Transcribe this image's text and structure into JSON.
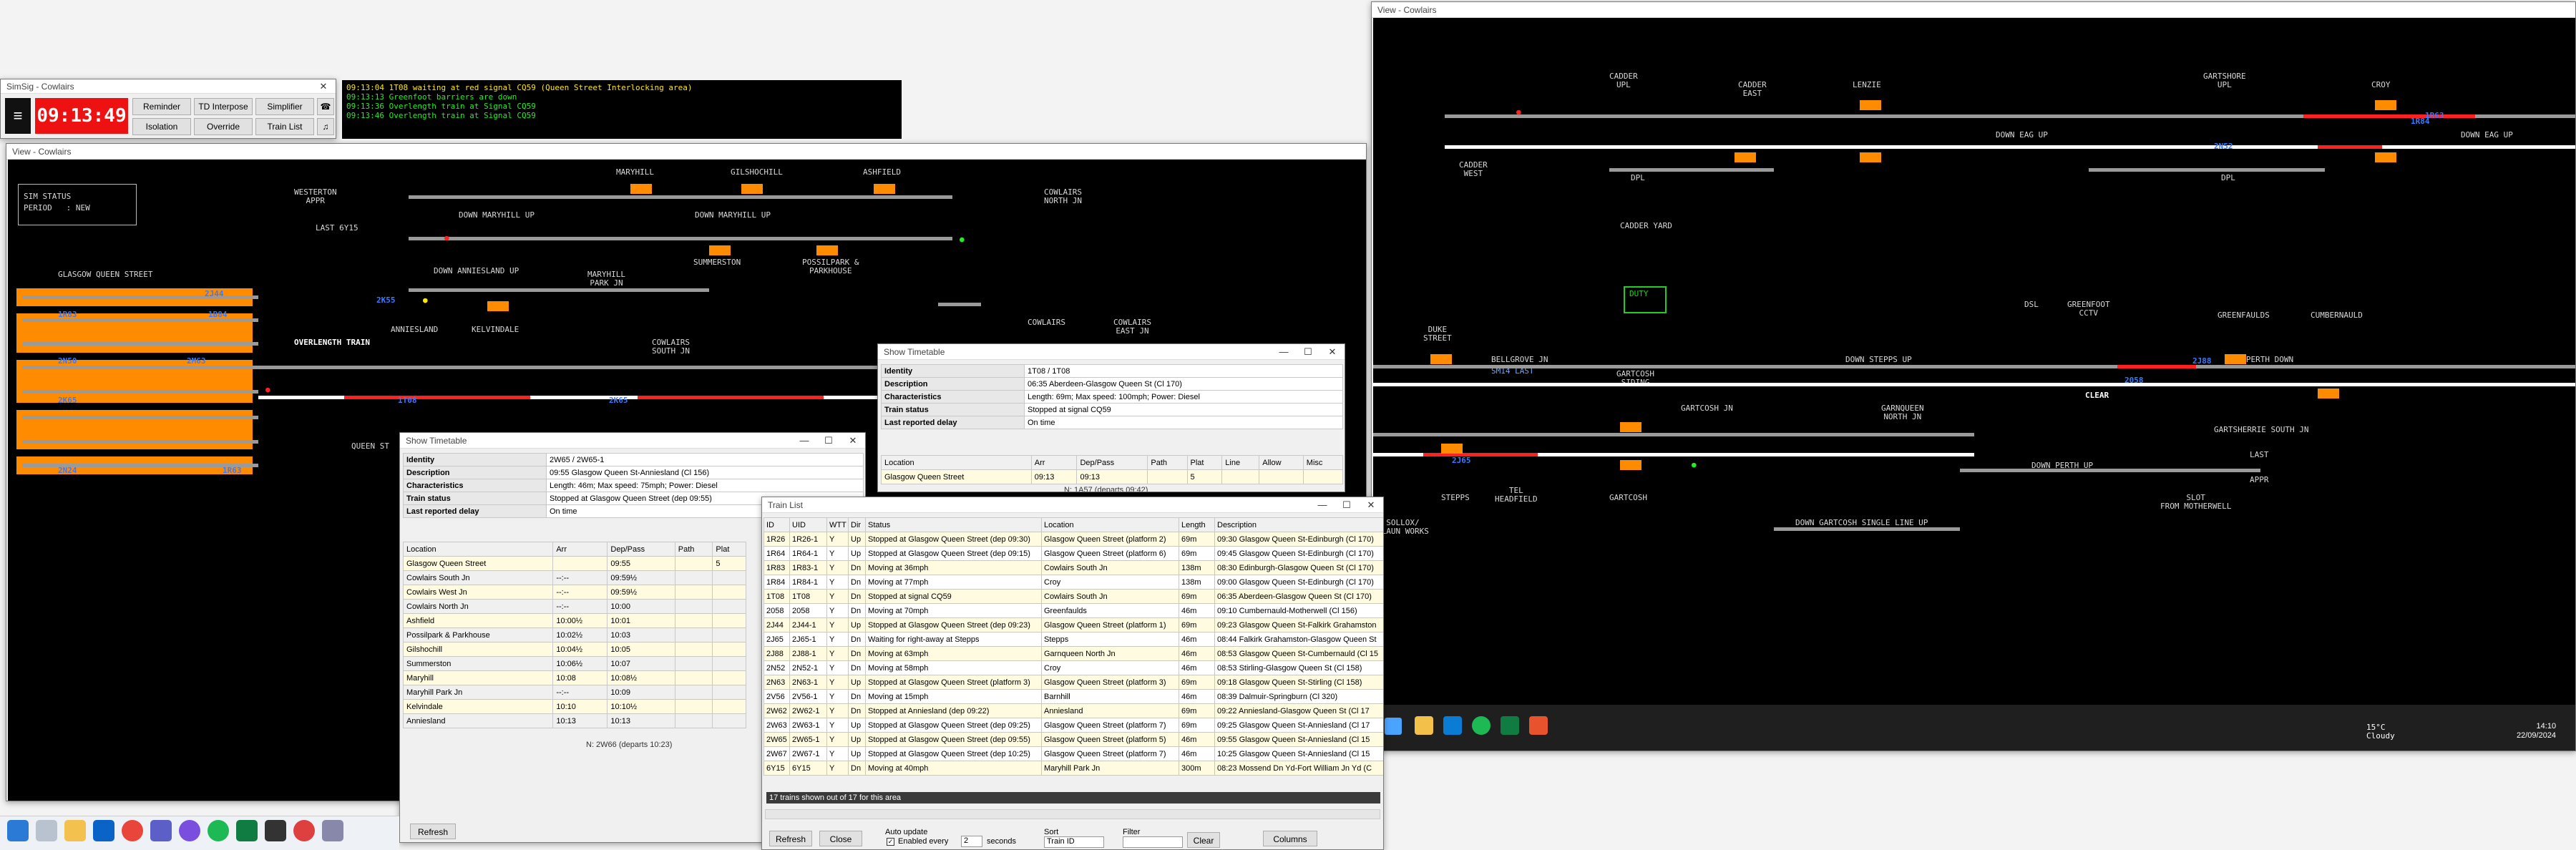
{
  "simsig": {
    "title": "SimSig - Cowlairs",
    "clock": "09:13:49",
    "buttons": {
      "reminder": "Reminder",
      "td_interpose": "TD Interpose",
      "simplifier": "Simplifier",
      "isolation": "Isolation",
      "override": "Override",
      "train_list": "Train List"
    },
    "messages": [
      "09:13:04 1T08 waiting at red signal CQ59 (Queen Street Interlocking area)",
      "09:13:13 Greenfoot barriers are down",
      "09:13:36 Overlength train at Signal CQ59",
      "09:13:46 Overlength train at Signal CQ59"
    ]
  },
  "left_view": {
    "title": "View - Cowlairs",
    "sim_status": "SIM STATUS",
    "period": "PERIOD   : NEW",
    "labels": {
      "westerton": "WESTERTON\nAPPR",
      "last_6y15": "LAST 6Y15",
      "glasgow_qs": "GLASGOW QUEEN STREET",
      "maryhill": "MARYHILL",
      "gilshochill": "GILSHOCHILL",
      "ashfield": "ASHFIELD",
      "cowlairs_north": "COWLAIRS\nNORTH JN",
      "down_maryhill_up": "DOWN MARYHILL UP",
      "down_anniesland_up": "DOWN ANNIESLAND UP",
      "maryhill_park": "MARYHILL\nPARK JN",
      "summerston": "SUMMERSTON",
      "possilpark": "POSSILPARK &\nPARKHOUSE",
      "anniesland": "ANNIESLAND",
      "kelvindale": "KELVINDALE",
      "overlength": "OVERLENGTH TRAIN",
      "cowlairs_south": "COWLAIRS\nSOUTH JN",
      "cowlairs": "COWLAIRS",
      "cowlairs_east": "COWLAIRS\nEAST JN",
      "queen_st": "QUEEN ST"
    },
    "headcodes": [
      "1R83",
      "1B84",
      "2N50",
      "2M63",
      "2K65",
      "1T08",
      "2N24",
      "2J44",
      "1R63",
      "2K65",
      "2K55"
    ]
  },
  "timetable_1": {
    "title": "Show Timetable",
    "fields": [
      {
        "k": "Identity",
        "v": "2W65 / 2W65-1"
      },
      {
        "k": "Description",
        "v": "09:55 Glasgow Queen St-Anniesland (Cl 156)"
      },
      {
        "k": "Characteristics",
        "v": "Length: 46m; Max speed: 75mph; Power: Diesel"
      },
      {
        "k": "Train status",
        "v": "Stopped at Glasgow Queen Street (dep 09:55)"
      },
      {
        "k": "Last reported delay",
        "v": "On time"
      }
    ],
    "columns": [
      "Location",
      "Arr",
      "Dep/Pass",
      "Path",
      "Plat"
    ],
    "rows": [
      [
        "Glasgow Queen Street",
        "",
        "09:55",
        "",
        "5"
      ],
      [
        "Cowlairs South Jn",
        "--:--",
        "09:59½",
        "",
        ""
      ],
      [
        "Cowlairs West Jn",
        "--:--",
        "09:59½",
        "",
        ""
      ],
      [
        "Cowlairs North Jn",
        "--:--",
        "10:00",
        "",
        ""
      ],
      [
        "Ashfield",
        "10:00½",
        "10:01",
        "",
        ""
      ],
      [
        "Possilpark & Parkhouse",
        "10:02½",
        "10:03",
        "",
        ""
      ],
      [
        "Gilshochill",
        "10:04½",
        "10:05",
        "",
        ""
      ],
      [
        "Summerston",
        "10:06½",
        "10:07",
        "",
        ""
      ],
      [
        "Maryhill",
        "10:08",
        "10:08½",
        "",
        ""
      ],
      [
        "Maryhill Park Jn",
        "--:--",
        "10:09",
        "",
        ""
      ],
      [
        "Kelvindale",
        "10:10",
        "10:10½",
        "",
        ""
      ],
      [
        "Anniesland",
        "10:13",
        "10:13",
        "",
        ""
      ]
    ],
    "footer": "N: 2W66 (departs 10:23)",
    "refresh": "Refresh"
  },
  "timetable_2": {
    "title": "Show Timetable",
    "fields": [
      {
        "k": "Identity",
        "v": "1T08 / 1T08"
      },
      {
        "k": "Description",
        "v": "06:35 Aberdeen-Glasgow Queen St (Cl 170)"
      },
      {
        "k": "Characteristics",
        "v": "Length: 69m; Max speed: 100mph; Power: Diesel"
      },
      {
        "k": "Train status",
        "v": "Stopped at signal CQ59"
      },
      {
        "k": "Last reported delay",
        "v": "On time"
      }
    ],
    "columns": [
      "Location",
      "Arr",
      "Dep/Pass",
      "Path",
      "Plat",
      "Line",
      "Allow",
      "Misc"
    ],
    "rows": [
      [
        "Glasgow Queen Street",
        "09:13",
        "09:13",
        "",
        "5",
        "",
        "",
        ""
      ]
    ],
    "footer": "N: 1A57 (departs 09:42)"
  },
  "train_list": {
    "title": "Train List",
    "columns": [
      "ID",
      "UID",
      "WTT",
      "Dir",
      "Status",
      "Location",
      "Length",
      "Description"
    ],
    "rows": [
      [
        "1R26",
        "1R26-1",
        "Y",
        "Up",
        "Stopped at Glasgow Queen Street (dep 09:30)",
        "Glasgow Queen Street (platform 2)",
        "69m",
        "09:30 Glasgow Queen St-Edinburgh (Cl 170)"
      ],
      [
        "1R64",
        "1R64-1",
        "Y",
        "Up",
        "Stopped at Glasgow Queen Street (dep 09:15)",
        "Glasgow Queen Street (platform 6)",
        "69m",
        "09:45 Glasgow Queen St-Edinburgh (Cl 170)"
      ],
      [
        "1R83",
        "1R83-1",
        "Y",
        "Dn",
        "Moving at 36mph",
        "Cowlairs South Jn",
        "138m",
        "08:30 Edinburgh-Glasgow Queen St (Cl 170)"
      ],
      [
        "1R84",
        "1R84-1",
        "Y",
        "Dn",
        "Moving at 77mph",
        "Croy",
        "138m",
        "09:00 Glasgow Queen St-Edinburgh (Cl 170)"
      ],
      [
        "1T08",
        "1T08",
        "Y",
        "Dn",
        "Stopped at signal CQ59",
        "Cowlairs South Jn",
        "69m",
        "06:35 Aberdeen-Glasgow Queen St (Cl 170)"
      ],
      [
        "2058",
        "2058",
        "Y",
        "Dn",
        "Moving at 70mph",
        "Greenfaulds",
        "46m",
        "09:10 Cumbernauld-Motherwell (Cl 156)"
      ],
      [
        "2J44",
        "2J44-1",
        "Y",
        "Up",
        "Stopped at Glasgow Queen Street (dep 09:23)",
        "Glasgow Queen Street (platform 1)",
        "69m",
        "09:23 Glasgow Queen St-Falkirk Grahamston"
      ],
      [
        "2J65",
        "2J65-1",
        "Y",
        "Dn",
        "Waiting for right-away at Stepps",
        "Stepps",
        "46m",
        "08:44 Falkirk Grahamston-Glasgow Queen St"
      ],
      [
        "2J88",
        "2J88-1",
        "Y",
        "Dn",
        "Moving at 63mph",
        "Garnqueen North Jn",
        "46m",
        "08:53 Glasgow Queen St-Cumbernauld (Cl 15"
      ],
      [
        "2N52",
        "2N52-1",
        "Y",
        "Dn",
        "Moving at 58mph",
        "Croy",
        "46m",
        "08:53 Stirling-Glasgow Queen St (Cl 158)"
      ],
      [
        "2N63",
        "2N63-1",
        "Y",
        "Up",
        "Stopped at Glasgow Queen Street (platform 3)",
        "Glasgow Queen Street (platform 3)",
        "69m",
        "09:18 Glasgow Queen St-Stirling (Cl 158)"
      ],
      [
        "2V56",
        "2V56-1",
        "Y",
        "Dn",
        "Moving at 15mph",
        "Barnhill",
        "46m",
        "08:39 Dalmuir-Springburn (Cl 320)"
      ],
      [
        "2W62",
        "2W62-1",
        "Y",
        "Dn",
        "Stopped at Anniesland (dep 09:22)",
        "Anniesland",
        "69m",
        "09:22 Anniesland-Glasgow Queen St (Cl 17"
      ],
      [
        "2W63",
        "2W63-1",
        "Y",
        "Up",
        "Stopped at Glasgow Queen Street (dep 09:25)",
        "Glasgow Queen Street (platform 7)",
        "69m",
        "09:25 Glasgow Queen St-Anniesland (Cl 17"
      ],
      [
        "2W65",
        "2W65-1",
        "Y",
        "Up",
        "Stopped at Glasgow Queen Street (dep 09:55)",
        "Glasgow Queen Street (platform 5)",
        "46m",
        "09:55 Glasgow Queen St-Anniesland (Cl 15"
      ],
      [
        "2W67",
        "2W67-1",
        "Y",
        "Up",
        "Stopped at Glasgow Queen Street (dep 10:25)",
        "Glasgow Queen Street (platform 7)",
        "46m",
        "10:25 Glasgow Queen St-Anniesland (Cl 15"
      ],
      [
        "6Y15",
        "6Y15",
        "Y",
        "Dn",
        "Moving at 40mph",
        "Maryhill Park Jn",
        "300m",
        "08:23 Mossend Dn Yd-Fort William Jn Yd (C"
      ]
    ],
    "status_line": "17 trains shown out of 17 for this area",
    "refresh": "Refresh",
    "close": "Close",
    "auto_update": "Auto update",
    "enabled_every": "Enabled every",
    "interval": "2",
    "seconds": "seconds",
    "sort": "Sort",
    "sort_value": "Train ID",
    "filter": "Filter",
    "clear": "Clear",
    "columns_btn": "Columns"
  },
  "right_view": {
    "title": "View - Cowlairs",
    "labels": {
      "cadder_upl": "CADDER\nUPL",
      "cadder_east": "CADDER\nEAST",
      "lenzie": "LENZIE",
      "gartshore": "GARTSHORE\nUPL",
      "croy": "CROY",
      "down_eag_up": "DOWN EAG UP",
      "down_eag_up2": "DOWN EAG UP",
      "cadder_west": "CADDER\nWEST",
      "dpl": "DPL",
      "dpl2": "DPL",
      "cadder_yard": "CADDER YARD",
      "dsl": "DSL",
      "greenfoot": "GREENFOOT\nCCTV",
      "greenfaulds": "GREENFAULDS",
      "cumbernauld": "CUMBERNAULD",
      "duke_street": "DUKE\nSTREET",
      "bellgrove": "BELLGROVE JN",
      "sm14_last": "SM14 LAST",
      "down_stepps_up": "DOWN STEPPS UP",
      "up_perth_down": "UP PERTH DOWN",
      "clear": "CLEAR",
      "gartcosh_siding": "GARTCOSH\nSIDING",
      "gartcosh_jn": "GARTCOSH JN",
      "garnqueen": "GARNQUEEN\nNORTH JN",
      "gartsherrie": "GARTSHERRIE SOUTH JN",
      "down_perth_up": "DOWN PERTH UP",
      "last": "LAST",
      "appr": "APPR",
      "slot": "SLOT\nFROM MOTHERWELL",
      "stepps": "STEPPS",
      "tel_headfield": "TEL\nHEADFIELD",
      "gartcosh": "GARTCOSH",
      "down_gartcosh": "DOWN GARTCOSH SINGLE LINE UP",
      "duty": "DUTY",
      "sollox": "SOLLOX/\nGLAUN WORKS"
    },
    "headcodes": [
      "1R84",
      "2N52",
      "2J88",
      "1R63",
      "2J65",
      "2058"
    ]
  },
  "taskbar": {
    "weather_temp": "15°C",
    "weather_text": "Cloudy",
    "time": "14:10",
    "date": "22/09/2024"
  }
}
